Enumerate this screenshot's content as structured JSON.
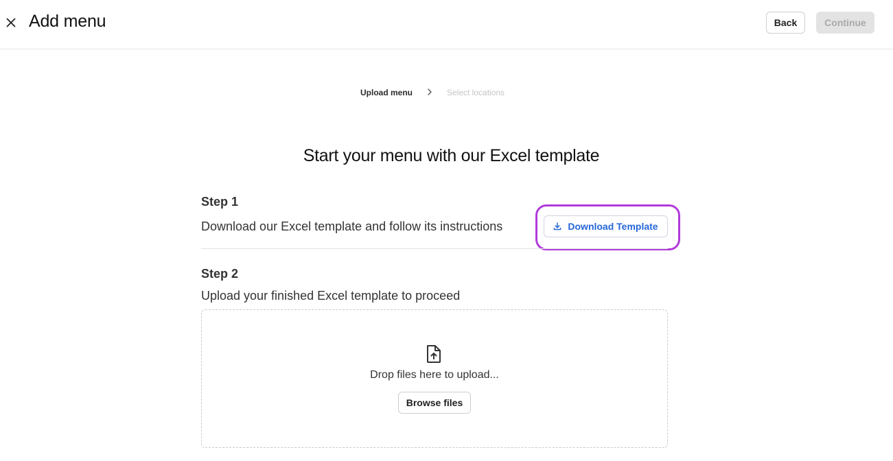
{
  "header": {
    "title": "Add menu",
    "close_icon": "close-icon",
    "back_label": "Back",
    "continue_label": "Continue"
  },
  "stepper": {
    "steps": [
      {
        "label": "Upload menu",
        "state": "active"
      },
      {
        "label": "Select locations",
        "state": "inactive"
      }
    ],
    "separator_icon": "chevron-right-icon"
  },
  "main": {
    "heading": "Start your menu with our Excel template",
    "step1": {
      "label": "Step 1",
      "description": "Download our Excel template and follow its instructions",
      "button_label": "Download Template",
      "button_icon": "download-icon"
    },
    "step2": {
      "label": "Step 2",
      "description": "Upload your finished Excel template to proceed",
      "dropzone": {
        "icon": "file-upload-icon",
        "text": "Drop files here to upload...",
        "browse_label": "Browse files"
      }
    }
  },
  "colors": {
    "accent_blue": "#2667d9",
    "highlight_purple": "#b13adb",
    "disabled_bg": "#e3e3e3",
    "disabled_text": "#a9a9a9"
  }
}
